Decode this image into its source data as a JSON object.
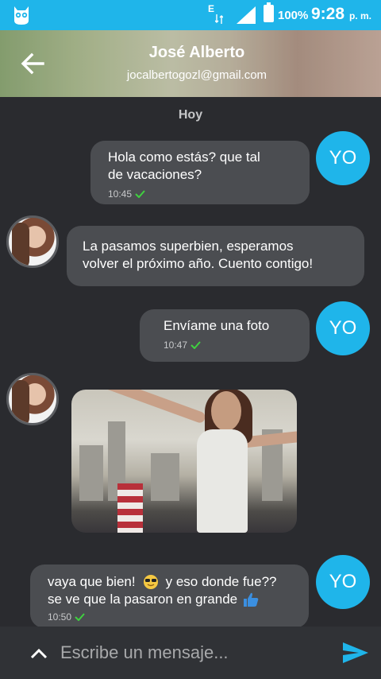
{
  "status_bar": {
    "network": "E",
    "battery": "100%",
    "time": "9:28",
    "ampm": "p. m."
  },
  "header": {
    "name": "José Alberto",
    "email": "jocalbertogozl@gmail.com"
  },
  "date_separator": "Hoy",
  "messages": [
    {
      "from": "me",
      "text": "Hola como estás? que tal de vacaciones?",
      "line1": "Hola como estás? que tal",
      "line2": "de vacaciones?",
      "time": "10:45",
      "avatar": "YO"
    },
    {
      "from": "contact",
      "line1": "La pasamos superbien, esperamos",
      "line2": "volver el próximo año. Cuento contigo!"
    },
    {
      "from": "me",
      "text": "Envíame una foto",
      "time": "10:47",
      "avatar": "YO"
    },
    {
      "from": "contact",
      "type": "photo"
    },
    {
      "from": "me",
      "line1a": "vaya que bien!",
      "line1b": "y eso donde fue??",
      "line2": "se ve que la pasaron en grande",
      "time": "10:50",
      "avatar": "YO",
      "emojis": [
        "sunglasses-emoji",
        "thumbs-up-emoji"
      ]
    }
  ],
  "composer": {
    "placeholder": "Escribe un mensaje..."
  },
  "colors": {
    "accent": "#1fb5ea",
    "bubble": "#4b4d51",
    "background": "#2a2b2f",
    "check": "#3fd13f"
  }
}
